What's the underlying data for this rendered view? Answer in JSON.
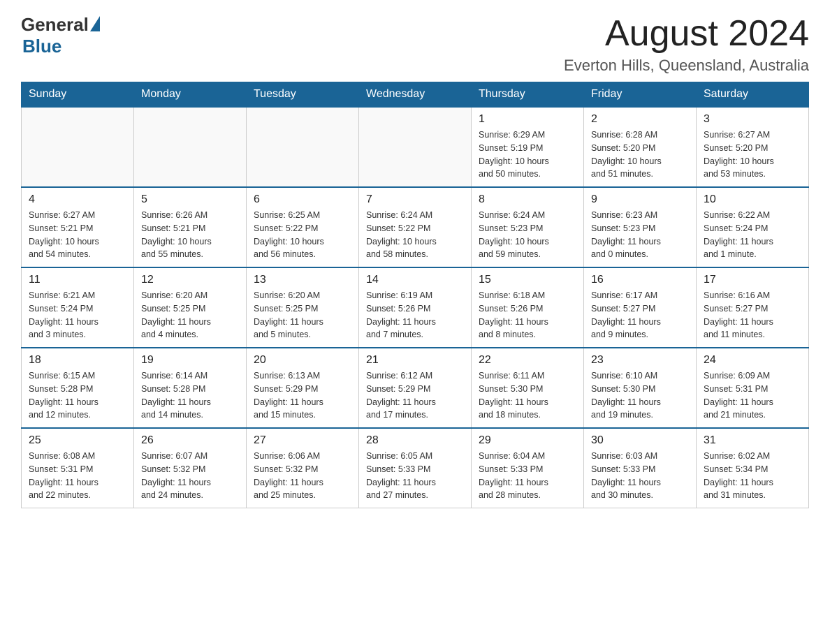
{
  "header": {
    "logo_general": "General",
    "logo_blue": "Blue",
    "month_title": "August 2024",
    "location": "Everton Hills, Queensland, Australia"
  },
  "weekdays": [
    "Sunday",
    "Monday",
    "Tuesday",
    "Wednesday",
    "Thursday",
    "Friday",
    "Saturday"
  ],
  "weeks": [
    [
      {
        "day": "",
        "info": ""
      },
      {
        "day": "",
        "info": ""
      },
      {
        "day": "",
        "info": ""
      },
      {
        "day": "",
        "info": ""
      },
      {
        "day": "1",
        "info": "Sunrise: 6:29 AM\nSunset: 5:19 PM\nDaylight: 10 hours\nand 50 minutes."
      },
      {
        "day": "2",
        "info": "Sunrise: 6:28 AM\nSunset: 5:20 PM\nDaylight: 10 hours\nand 51 minutes."
      },
      {
        "day": "3",
        "info": "Sunrise: 6:27 AM\nSunset: 5:20 PM\nDaylight: 10 hours\nand 53 minutes."
      }
    ],
    [
      {
        "day": "4",
        "info": "Sunrise: 6:27 AM\nSunset: 5:21 PM\nDaylight: 10 hours\nand 54 minutes."
      },
      {
        "day": "5",
        "info": "Sunrise: 6:26 AM\nSunset: 5:21 PM\nDaylight: 10 hours\nand 55 minutes."
      },
      {
        "day": "6",
        "info": "Sunrise: 6:25 AM\nSunset: 5:22 PM\nDaylight: 10 hours\nand 56 minutes."
      },
      {
        "day": "7",
        "info": "Sunrise: 6:24 AM\nSunset: 5:22 PM\nDaylight: 10 hours\nand 58 minutes."
      },
      {
        "day": "8",
        "info": "Sunrise: 6:24 AM\nSunset: 5:23 PM\nDaylight: 10 hours\nand 59 minutes."
      },
      {
        "day": "9",
        "info": "Sunrise: 6:23 AM\nSunset: 5:23 PM\nDaylight: 11 hours\nand 0 minutes."
      },
      {
        "day": "10",
        "info": "Sunrise: 6:22 AM\nSunset: 5:24 PM\nDaylight: 11 hours\nand 1 minute."
      }
    ],
    [
      {
        "day": "11",
        "info": "Sunrise: 6:21 AM\nSunset: 5:24 PM\nDaylight: 11 hours\nand 3 minutes."
      },
      {
        "day": "12",
        "info": "Sunrise: 6:20 AM\nSunset: 5:25 PM\nDaylight: 11 hours\nand 4 minutes."
      },
      {
        "day": "13",
        "info": "Sunrise: 6:20 AM\nSunset: 5:25 PM\nDaylight: 11 hours\nand 5 minutes."
      },
      {
        "day": "14",
        "info": "Sunrise: 6:19 AM\nSunset: 5:26 PM\nDaylight: 11 hours\nand 7 minutes."
      },
      {
        "day": "15",
        "info": "Sunrise: 6:18 AM\nSunset: 5:26 PM\nDaylight: 11 hours\nand 8 minutes."
      },
      {
        "day": "16",
        "info": "Sunrise: 6:17 AM\nSunset: 5:27 PM\nDaylight: 11 hours\nand 9 minutes."
      },
      {
        "day": "17",
        "info": "Sunrise: 6:16 AM\nSunset: 5:27 PM\nDaylight: 11 hours\nand 11 minutes."
      }
    ],
    [
      {
        "day": "18",
        "info": "Sunrise: 6:15 AM\nSunset: 5:28 PM\nDaylight: 11 hours\nand 12 minutes."
      },
      {
        "day": "19",
        "info": "Sunrise: 6:14 AM\nSunset: 5:28 PM\nDaylight: 11 hours\nand 14 minutes."
      },
      {
        "day": "20",
        "info": "Sunrise: 6:13 AM\nSunset: 5:29 PM\nDaylight: 11 hours\nand 15 minutes."
      },
      {
        "day": "21",
        "info": "Sunrise: 6:12 AM\nSunset: 5:29 PM\nDaylight: 11 hours\nand 17 minutes."
      },
      {
        "day": "22",
        "info": "Sunrise: 6:11 AM\nSunset: 5:30 PM\nDaylight: 11 hours\nand 18 minutes."
      },
      {
        "day": "23",
        "info": "Sunrise: 6:10 AM\nSunset: 5:30 PM\nDaylight: 11 hours\nand 19 minutes."
      },
      {
        "day": "24",
        "info": "Sunrise: 6:09 AM\nSunset: 5:31 PM\nDaylight: 11 hours\nand 21 minutes."
      }
    ],
    [
      {
        "day": "25",
        "info": "Sunrise: 6:08 AM\nSunset: 5:31 PM\nDaylight: 11 hours\nand 22 minutes."
      },
      {
        "day": "26",
        "info": "Sunrise: 6:07 AM\nSunset: 5:32 PM\nDaylight: 11 hours\nand 24 minutes."
      },
      {
        "day": "27",
        "info": "Sunrise: 6:06 AM\nSunset: 5:32 PM\nDaylight: 11 hours\nand 25 minutes."
      },
      {
        "day": "28",
        "info": "Sunrise: 6:05 AM\nSunset: 5:33 PM\nDaylight: 11 hours\nand 27 minutes."
      },
      {
        "day": "29",
        "info": "Sunrise: 6:04 AM\nSunset: 5:33 PM\nDaylight: 11 hours\nand 28 minutes."
      },
      {
        "day": "30",
        "info": "Sunrise: 6:03 AM\nSunset: 5:33 PM\nDaylight: 11 hours\nand 30 minutes."
      },
      {
        "day": "31",
        "info": "Sunrise: 6:02 AM\nSunset: 5:34 PM\nDaylight: 11 hours\nand 31 minutes."
      }
    ]
  ]
}
